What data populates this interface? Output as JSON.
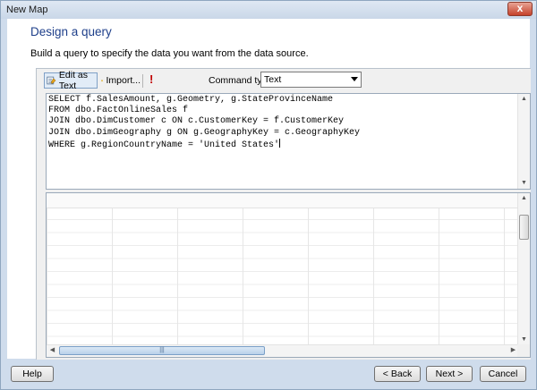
{
  "window": {
    "title": "New Map",
    "close_label": "x"
  },
  "page": {
    "heading": "Design a query",
    "description": "Build a query to specify the data you want from the data source."
  },
  "toolbar": {
    "edit_as_text": "Edit as Text",
    "import": "Import...",
    "run_icon_label": "!",
    "command_type_label": "Command type:",
    "command_type_value": "Text"
  },
  "query": {
    "lines": [
      "SELECT f.SalesAmount, g.Geometry, g.StateProvinceName",
      "FROM dbo.FactOnlineSales f",
      "JOIN dbo.DimCustomer c ON c.CustomerKey = f.CustomerKey",
      "JOIN dbo.DimGeography g ON g.GeographyKey = c.GeographyKey",
      "WHERE g.RegionCountryName = 'United States'"
    ]
  },
  "scroll": {
    "thumb_grip": "|||"
  },
  "footer": {
    "help": "Help",
    "back": "< Back",
    "next": "Next >",
    "cancel": "Cancel"
  },
  "colors": {
    "heading": "#1e3f8a",
    "run_icon": "#c00000",
    "window_frame": "#cfdcec"
  }
}
